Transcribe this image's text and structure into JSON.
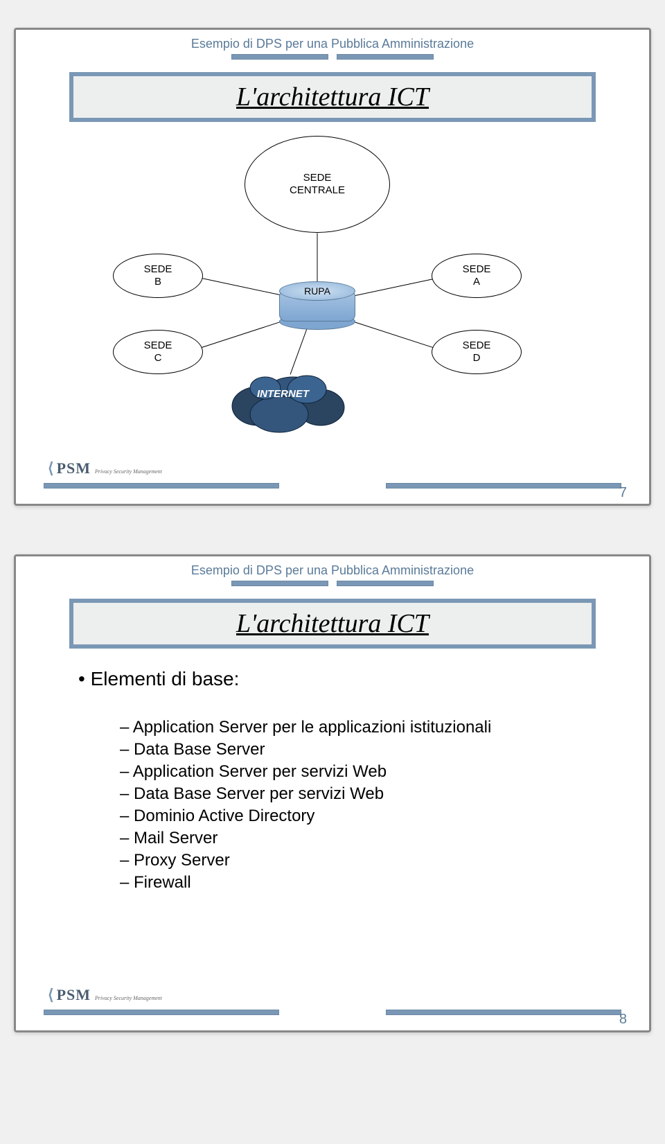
{
  "header_text": "Esempio di DPS per una Pubblica Amministrazione",
  "slide1": {
    "title": "L'architettura ICT",
    "nodes": {
      "centrale_l1": "SEDE",
      "centrale_l2": "CENTRALE",
      "b_l1": "SEDE",
      "b_l2": "B",
      "a_l1": "SEDE",
      "a_l2": "A",
      "c_l1": "SEDE",
      "c_l2": "C",
      "d_l1": "SEDE",
      "d_l2": "D",
      "rupa": "RUPA",
      "internet": "INTERNET"
    },
    "page": "7",
    "logo": "PSM",
    "logo_sub": "Privacy Security Management"
  },
  "slide2": {
    "title": "L'architettura ICT",
    "heading": "Elementi di base:",
    "items": [
      "Application Server per le applicazioni istituzionali",
      "Data Base Server",
      "Application Server per servizi Web",
      "Data Base Server per servizi Web",
      "Dominio Active Directory",
      "Mail Server",
      "Proxy Server",
      "Firewall"
    ],
    "page": "8",
    "logo": "PSM",
    "logo_sub": "Privacy Security Management"
  }
}
